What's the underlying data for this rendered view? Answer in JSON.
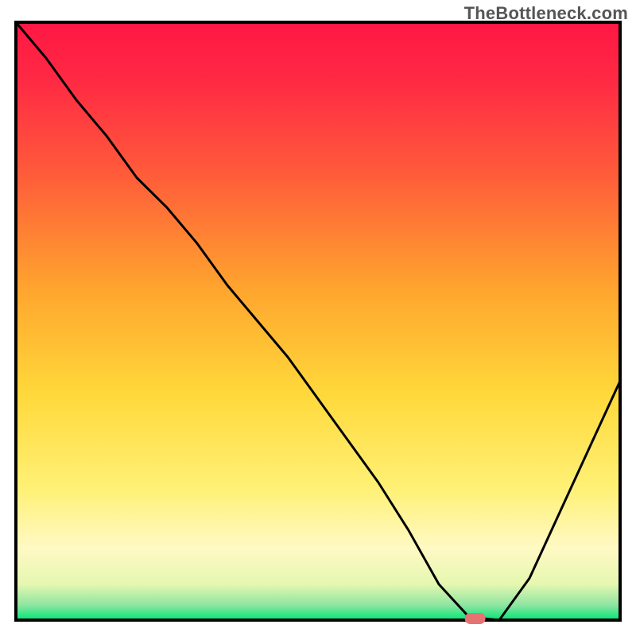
{
  "watermark": "TheBottleneck.com",
  "chart_data": {
    "type": "line",
    "title": "",
    "xlabel": "",
    "ylabel": "",
    "xlim": [
      0,
      100
    ],
    "ylim": [
      0,
      100
    ],
    "x": [
      0,
      5,
      10,
      15,
      20,
      25,
      30,
      35,
      40,
      45,
      50,
      55,
      60,
      65,
      70,
      75,
      80,
      85,
      90,
      95,
      100
    ],
    "values": [
      100,
      94,
      87,
      81,
      74,
      69,
      63,
      56,
      50,
      44,
      37,
      30,
      23,
      15,
      6,
      0.5,
      0,
      7,
      18,
      29,
      40
    ],
    "minimum_x": 76,
    "background": {
      "stops": [
        {
          "offset": 0.0,
          "color": "#ff1744"
        },
        {
          "offset": 0.1,
          "color": "#ff2a44"
        },
        {
          "offset": 0.25,
          "color": "#ff5a3a"
        },
        {
          "offset": 0.45,
          "color": "#ffa62e"
        },
        {
          "offset": 0.62,
          "color": "#ffd83a"
        },
        {
          "offset": 0.78,
          "color": "#fff176"
        },
        {
          "offset": 0.88,
          "color": "#fff9c4"
        },
        {
          "offset": 0.94,
          "color": "#e6f7b0"
        },
        {
          "offset": 0.975,
          "color": "#8de5a1"
        },
        {
          "offset": 1.0,
          "color": "#00e676"
        }
      ]
    },
    "marker": {
      "x": 76,
      "y": 0,
      "color": "#e57373"
    }
  }
}
